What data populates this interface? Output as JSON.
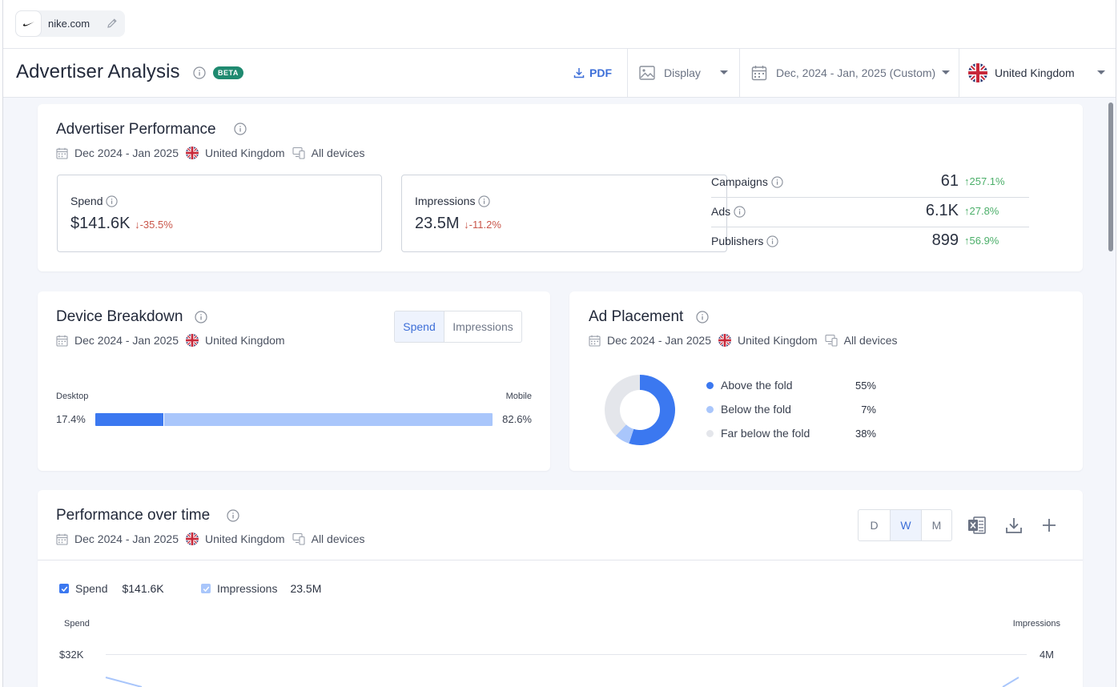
{
  "domain": {
    "name": "nike.com"
  },
  "header": {
    "title": "Advertiser Analysis",
    "beta": "BETA",
    "pdf_label": "PDF",
    "ad_type": "Display",
    "date_range": "Dec, 2024 - Jan, 2025 (Custom)",
    "country": "United Kingdom"
  },
  "performance": {
    "title": "Advertiser Performance",
    "date": "Dec 2024 - Jan 2025",
    "country": "United Kingdom",
    "devices": "All devices",
    "spend": {
      "label": "Spend",
      "value": "$141.6K",
      "change": "-35.5%"
    },
    "impressions": {
      "label": "Impressions",
      "value": "23.5M",
      "change": "-11.2%"
    },
    "stats": [
      {
        "label": "Campaigns",
        "value": "61",
        "change": "257.1%"
      },
      {
        "label": "Ads",
        "value": "6.1K",
        "change": "27.8%"
      },
      {
        "label": "Publishers",
        "value": "899",
        "change": "56.9%"
      }
    ]
  },
  "device_breakdown": {
    "title": "Device Breakdown",
    "date": "Dec 2024 - Jan 2025",
    "country": "United Kingdom",
    "toggle": [
      "Spend",
      "Impressions"
    ],
    "desktop_label": "Desktop",
    "mobile_label": "Mobile",
    "desktop_pct": "17.4%",
    "mobile_pct": "82.6%",
    "desktop_fraction": 0.174,
    "colors": {
      "desktop": "#3b78f0",
      "mobile": "#a9c6fb"
    }
  },
  "ad_placement": {
    "title": "Ad Placement",
    "date": "Dec 2024 - Jan 2025",
    "country": "United Kingdom",
    "devices": "All devices",
    "items": [
      {
        "label": "Above the fold",
        "value": "55%",
        "fraction": 0.55,
        "color": "#3b78f0"
      },
      {
        "label": "Below the fold",
        "value": "7%",
        "fraction": 0.07,
        "color": "#a9c6fb"
      },
      {
        "label": "Far below the fold",
        "value": "38%",
        "fraction": 0.38,
        "color": "#e4e6eb"
      }
    ]
  },
  "over_time": {
    "title": "Performance over time",
    "date": "Dec 2024 - Jan 2025",
    "country": "United Kingdom",
    "devices": "All devices",
    "granularity": [
      "D",
      "W",
      "M"
    ],
    "series": [
      {
        "label": "Spend",
        "total": "$141.6K"
      },
      {
        "label": "Impressions",
        "total": "23.5M"
      }
    ],
    "left_axis_title": "Spend",
    "right_axis_title": "Impressions",
    "left_tick": "$32K",
    "right_tick": "4M"
  }
}
